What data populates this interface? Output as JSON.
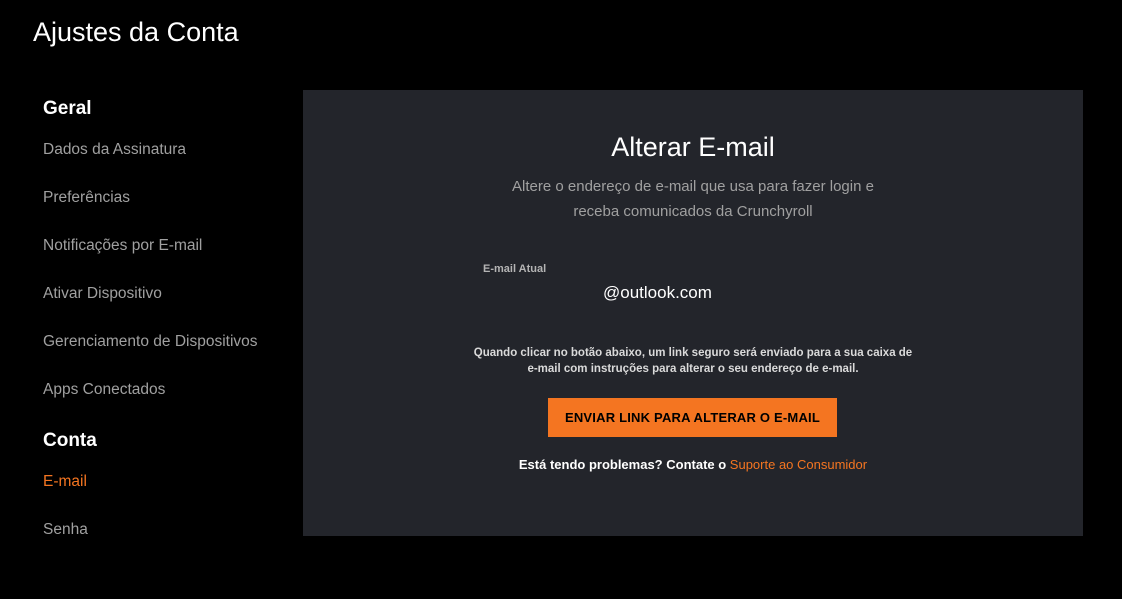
{
  "page": {
    "title": "Ajustes da Conta"
  },
  "sidebar": {
    "geral": {
      "heading": "Geral",
      "items": [
        {
          "label": "Dados da Assinatura"
        },
        {
          "label": "Preferências"
        },
        {
          "label": "Notificações por E-mail"
        },
        {
          "label": "Ativar Dispositivo"
        },
        {
          "label": "Gerenciamento de Dispositivos"
        },
        {
          "label": "Apps Conectados"
        }
      ]
    },
    "conta": {
      "heading": "Conta",
      "items": [
        {
          "label": "E-mail",
          "active": true
        },
        {
          "label": "Senha"
        }
      ]
    }
  },
  "panel": {
    "title": "Alterar E-mail",
    "subtitle": "Altere o endereço de e-mail que usa para fazer login e receba comunicados da Crunchyroll",
    "current_email_label": "E-mail Atual",
    "current_email_value": "@outlook.com",
    "notice": "Quando clicar no botão abaixo, um link seguro será enviado para a sua caixa de e-mail com instruções para alterar o seu endereço de e-mail.",
    "send_button_label": "ENVIAR LINK PARA ALTERAR O E-MAIL",
    "help_text": "Está tendo problemas? Contate o ",
    "support_link_label": "Suporte ao Consumidor"
  },
  "colors": {
    "accent": "#f47521",
    "background": "#000000",
    "panel": "#23252b",
    "muted_text": "#a0a0a0"
  }
}
